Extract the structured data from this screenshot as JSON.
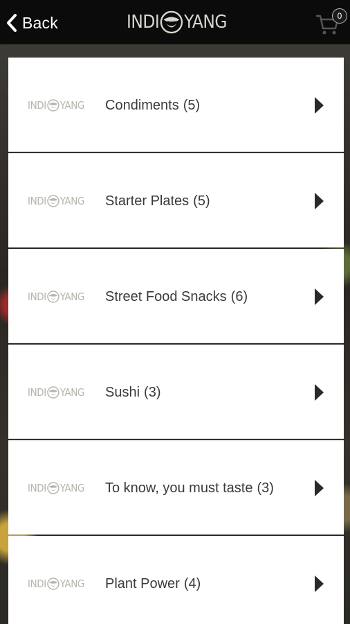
{
  "header": {
    "back_label": "Back",
    "brand_left": "INDI",
    "brand_right": "YANG",
    "cart_count": "0"
  },
  "categories": [
    {
      "name": "Condiments",
      "count": "(5)"
    },
    {
      "name": "Starter Plates",
      "count": "(5)"
    },
    {
      "name": "Street Food Snacks",
      "count": "(6)"
    },
    {
      "name": "Sushi",
      "count": "(3)"
    },
    {
      "name": "To know, you must taste",
      "count": "(3)"
    },
    {
      "name": "Plant Power",
      "count": "(4)"
    }
  ],
  "logo": {
    "left": "INDI",
    "right": "YANG"
  },
  "colors": {
    "topbar": "#0b0b0b",
    "card": "#ffffff",
    "text": "#3a3a3a",
    "logo": "#b7b5ad"
  }
}
